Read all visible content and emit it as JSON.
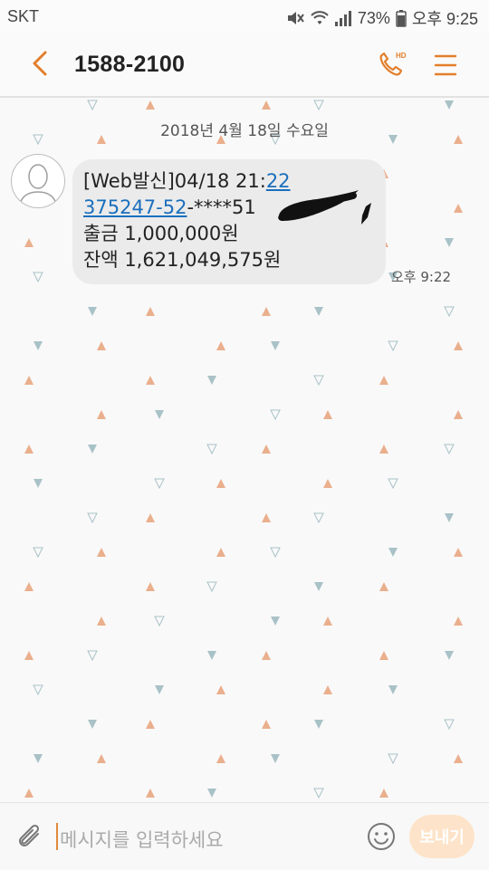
{
  "status_bar": {
    "carrier": "SKT",
    "battery": "73%",
    "time": "오후 9:25",
    "icons": [
      "mute-icon",
      "wifi-icon",
      "signal-icon",
      "battery-icon"
    ]
  },
  "app_bar": {
    "title": "1588-2100",
    "call_badge": "HD",
    "icons": [
      "back-arrow-icon",
      "phone-hd-icon",
      "menu-icon"
    ],
    "accent_color": "#e37e2b"
  },
  "chat": {
    "date_separator": "2018년 4월 18일 수요일",
    "messages": [
      {
        "line1_plain": "[Web발신]04/18  21:",
        "line1_link": "22",
        "line2_link": "375247-52",
        "line2_plain": "-****51",
        "line3": "출금 1,000,000원",
        "line4": "잔액 1,621,049,575원",
        "time": "오후 9:22"
      }
    ]
  },
  "input_bar": {
    "placeholder": "메시지를 입력하세요",
    "send_label": "보내기",
    "icons": [
      "paperclip-icon",
      "emoji-icon"
    ]
  }
}
